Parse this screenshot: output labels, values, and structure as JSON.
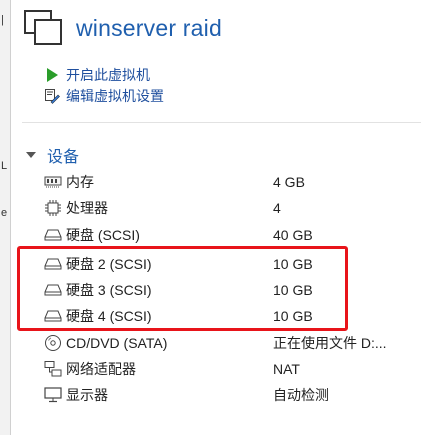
{
  "vm": {
    "title": "winserver raid"
  },
  "left_strip": {
    "fragments": [
      "|",
      "L",
      "e"
    ]
  },
  "actions": [
    {
      "label": "开启此虚拟机",
      "icon": "play-icon"
    },
    {
      "label": "编辑虚拟机设置",
      "icon": "edit-settings-icon"
    }
  ],
  "devices": {
    "section_label": "设备",
    "items": [
      {
        "name": "内存",
        "value": "4 GB",
        "icon": "memory-icon"
      },
      {
        "name": "处理器",
        "value": "4",
        "icon": "processor-icon"
      },
      {
        "name": "硬盘 (SCSI)",
        "value": "40 GB",
        "icon": "hard-disk-icon"
      },
      {
        "name": "硬盘 2 (SCSI)",
        "value": "10 GB",
        "icon": "hard-disk-icon"
      },
      {
        "name": "硬盘 3 (SCSI)",
        "value": "10 GB",
        "icon": "hard-disk-icon"
      },
      {
        "name": "硬盘 4 (SCSI)",
        "value": "10 GB",
        "icon": "hard-disk-icon"
      },
      {
        "name": "CD/DVD (SATA)",
        "value": "正在使用文件 D:...",
        "icon": "cd-dvd-icon"
      },
      {
        "name": "网络适配器",
        "value": "NAT",
        "icon": "network-adapter-icon"
      },
      {
        "name": "显示器",
        "value": "自动检测",
        "icon": "display-icon"
      }
    ]
  },
  "colors": {
    "accent": "#1f5fae",
    "highlight": "#e8141a",
    "play": "#2a9d2a"
  }
}
